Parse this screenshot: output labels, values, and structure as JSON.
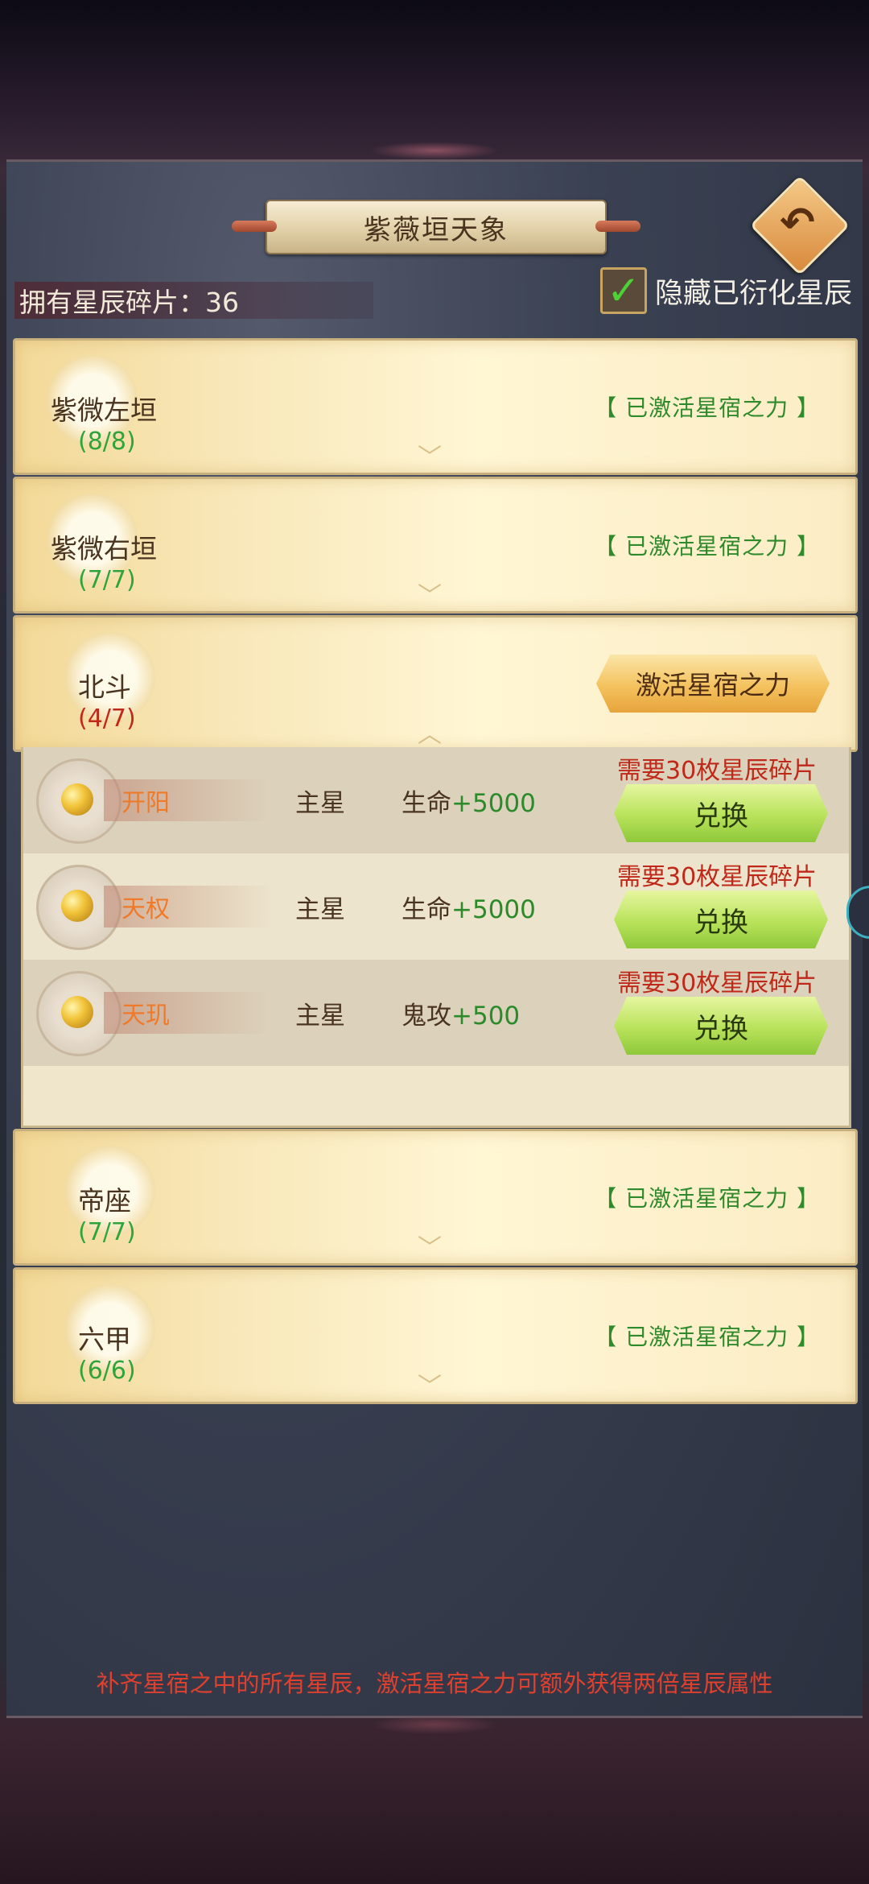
{
  "header": {
    "title": "紫薇垣天象",
    "back_icon": "back-arrow-icon",
    "shards_label": "拥有星辰碎片：36",
    "hide_checkbox_checked": true,
    "hide_label": "隐藏已衍化星辰"
  },
  "groups": [
    {
      "name": "紫微左垣",
      "count": "(8/8)",
      "status": "【 已激活星宿之力 】"
    },
    {
      "name": "紫微右垣",
      "count": "(7/7)",
      "status": "【 已激活星宿之力 】"
    },
    {
      "name": "北斗",
      "count": "(4/7)",
      "button": "激活星宿之力"
    },
    {
      "name": "帝座",
      "count": "(7/7)",
      "status": "【 已激活星宿之力 】"
    },
    {
      "name": "六甲",
      "count": "(6/6)",
      "status": "【 已激活星宿之力 】"
    }
  ],
  "stars": [
    {
      "name": "开阳",
      "type": "主星",
      "attr": "生命",
      "bonus": "+5000",
      "need": "需要30枚星辰碎片",
      "button": "兑换"
    },
    {
      "name": "天权",
      "type": "主星",
      "attr": "生命",
      "bonus": "+5000",
      "need": "需要30枚星辰碎片",
      "button": "兑换"
    },
    {
      "name": "天玑",
      "type": "主星",
      "attr": "鬼攻",
      "bonus": "+500",
      "need": "需要30枚星辰碎片",
      "button": "兑换"
    }
  ],
  "footer": "补齐星宿之中的所有星辰，激活星宿之力可额外获得两倍星辰属性",
  "colors": {
    "completed": "#2fa43a",
    "incomplete": "#c0281a",
    "warning": "#c0281a"
  }
}
